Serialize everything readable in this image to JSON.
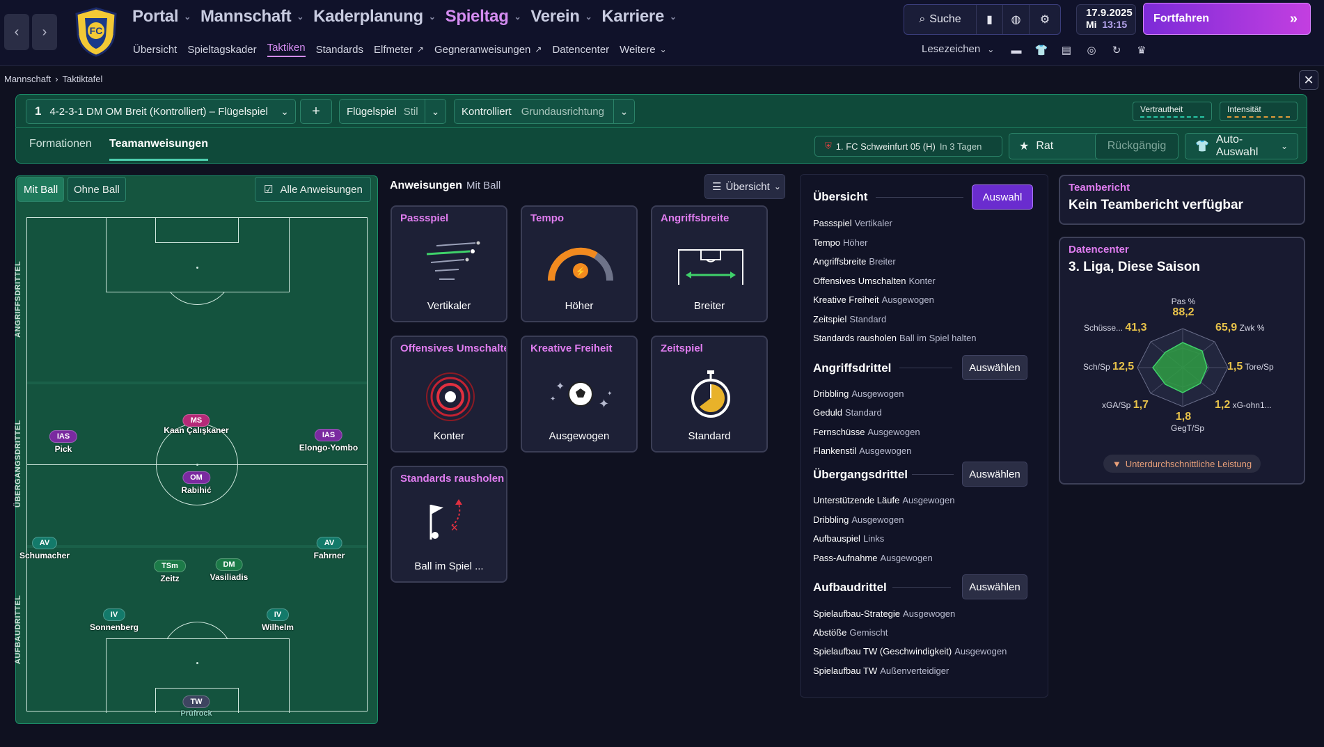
{
  "topbar": {
    "main_nav": [
      {
        "label": "Portal",
        "active": false
      },
      {
        "label": "Mannschaft",
        "active": false
      },
      {
        "label": "Kaderplanung",
        "active": false
      },
      {
        "label": "Spieltag",
        "active": true
      },
      {
        "label": "Verein",
        "active": false
      },
      {
        "label": "Karriere",
        "active": false
      }
    ],
    "sub_nav": [
      "Übersicht",
      "Spieltagskader",
      "Taktiken",
      "Standards",
      "Elfmeter",
      "Gegneranweisungen",
      "Datencenter",
      "Weitere"
    ],
    "sub_nav_active": "Taktiken",
    "search_label": "Suche",
    "date": "17.9.2025",
    "weekday": "Mi",
    "time": "13:15",
    "continue_label": "Fortfahren",
    "bookmarks_label": "Lesezeichen"
  },
  "breadcrumb": {
    "parent": "Mannschaft",
    "current": "Taktiktafel"
  },
  "tactic": {
    "slot": "1",
    "name": "4-2-3-1 DM OM Breit (Kontrolliert) – Flügelspiel",
    "add_label": "+",
    "style_value": "Flügelspiel",
    "style_label": "Stil",
    "mentality_value": "Kontrolliert",
    "mentality_label": "Grundausrichtung",
    "familiarity_label": "Vertrautheit",
    "intensity_label": "Intensität"
  },
  "tabs": {
    "formations": "Formationen",
    "team_instructions": "Teamanweisungen"
  },
  "opponent": {
    "name": "1. FC Schweinfurt 05 (H)",
    "when": "In 3 Tagen"
  },
  "actions": {
    "advice": "Rat",
    "undo": "Rückgängig",
    "auto_select": "Auto-Auswahl"
  },
  "pitch": {
    "with_ball": "Mit Ball",
    "without_ball": "Ohne Ball",
    "all_instructions": "Alle Anweisungen",
    "zones": [
      "ANGRIFFSDRITTEL",
      "ÜBERGANGSDRITTEL",
      "AUFBAUDRITTEL"
    ],
    "players": [
      {
        "role": "MS",
        "name": "Kaan Çalışkaner",
        "color": "#b52a78"
      },
      {
        "role": "IAS",
        "name": "Pick",
        "color": "#7a2aa0"
      },
      {
        "role": "IAS",
        "name": "Elongo-Yombo",
        "color": "#7a2aa0"
      },
      {
        "role": "OM",
        "name": "Rabihić",
        "color": "#7a2aa0"
      },
      {
        "role": "AV",
        "name": "Schumacher",
        "color": "#137a6a"
      },
      {
        "role": "AV",
        "name": "Fahrner",
        "color": "#137a6a"
      },
      {
        "role": "TSm",
        "name": "Zeitz",
        "color": "#1c7a48"
      },
      {
        "role": "DM",
        "name": "Vasiliadis",
        "color": "#1c7a48"
      },
      {
        "role": "IV",
        "name": "Sonnenberg",
        "color": "#137a6a"
      },
      {
        "role": "IV",
        "name": "Wilhelm",
        "color": "#137a6a"
      },
      {
        "role": "TW",
        "name": "Prüfrock",
        "color": "#3e4460"
      }
    ]
  },
  "instructions": {
    "title": "Anweisungen",
    "subtitle": "Mit Ball",
    "view_label": "Übersicht",
    "cards": [
      {
        "title": "Passspiel",
        "value": "Vertikaler",
        "icon": "pass-arrows-icon"
      },
      {
        "title": "Tempo",
        "value": "Höher",
        "icon": "tempo-gauge-icon"
      },
      {
        "title": "Angriffsbreite",
        "value": "Breiter",
        "icon": "width-goal-icon"
      },
      {
        "title": "Offensives Umschalten",
        "value": "Konter",
        "icon": "target-rings-icon"
      },
      {
        "title": "Kreative Freiheit",
        "value": "Ausgewogen",
        "icon": "ball-sparkle-icon"
      },
      {
        "title": "Zeitspiel",
        "value": "Standard",
        "icon": "stopwatch-icon"
      },
      {
        "title": "Standards rausholen",
        "value": "Ball im Spiel ...",
        "icon": "flag-kick-icon"
      }
    ]
  },
  "overview": {
    "title": "Übersicht",
    "select_label": "Auswahl",
    "choose_label": "Auswählen",
    "general": [
      {
        "k": "Passspiel",
        "v": "Vertikaler"
      },
      {
        "k": "Tempo",
        "v": "Höher"
      },
      {
        "k": "Angriffsbreite",
        "v": "Breiter"
      },
      {
        "k": "Offensives Umschalten",
        "v": "Konter"
      },
      {
        "k": "Kreative Freiheit",
        "v": "Ausgewogen"
      },
      {
        "k": "Zeitspiel",
        "v": "Standard"
      },
      {
        "k": "Standards rausholen",
        "v": "Ball im Spiel halten"
      }
    ],
    "attack_title": "Angriffsdrittel",
    "attack": [
      {
        "k": "Dribbling",
        "v": "Ausgewogen"
      },
      {
        "k": "Geduld",
        "v": "Standard"
      },
      {
        "k": "Fernschüsse",
        "v": "Ausgewogen"
      },
      {
        "k": "Flankenstil",
        "v": "Ausgewogen"
      }
    ],
    "transition_title": "Übergangsdrittel",
    "transition": [
      {
        "k": "Unterstützende Läufe",
        "v": "Ausgewogen"
      },
      {
        "k": "Dribbling",
        "v": "Ausgewogen"
      },
      {
        "k": "Aufbauspiel",
        "v": "Links"
      },
      {
        "k": "Pass-Aufnahme",
        "v": "Ausgewogen"
      }
    ],
    "buildup_title": "Aufbaudrittel",
    "buildup": [
      {
        "k": "Spielaufbau-Strategie",
        "v": "Ausgewogen"
      },
      {
        "k": "Abstöße",
        "v": "Gemischt"
      },
      {
        "k": "Spielaufbau TW (Geschwindigkeit)",
        "v": "Ausgewogen"
      },
      {
        "k": "Spielaufbau TW",
        "v": "Außenverteidiger"
      }
    ]
  },
  "team_report": {
    "title": "Teambericht",
    "text": "Kein Teambericht verfügbar"
  },
  "datacenter": {
    "title": "Datencenter",
    "subtitle": "3. Liga, Diese Saison",
    "stats": [
      {
        "label": "Pas %",
        "value": "88,2"
      },
      {
        "label": "Zwk %",
        "value": "65,9"
      },
      {
        "label": "Tore/Sp",
        "value": "1,5"
      },
      {
        "label": "xG-ohn1...",
        "value": "1,2"
      },
      {
        "label": "GegT/Sp",
        "value": "1,8"
      },
      {
        "label": "xGA/Sp",
        "value": "1,7"
      },
      {
        "label": "Sch/Sp",
        "value": "12,5"
      },
      {
        "label": "Schüsse...",
        "value": "41,3"
      }
    ],
    "performance": "Unterdurchschnittliche Leistung"
  }
}
